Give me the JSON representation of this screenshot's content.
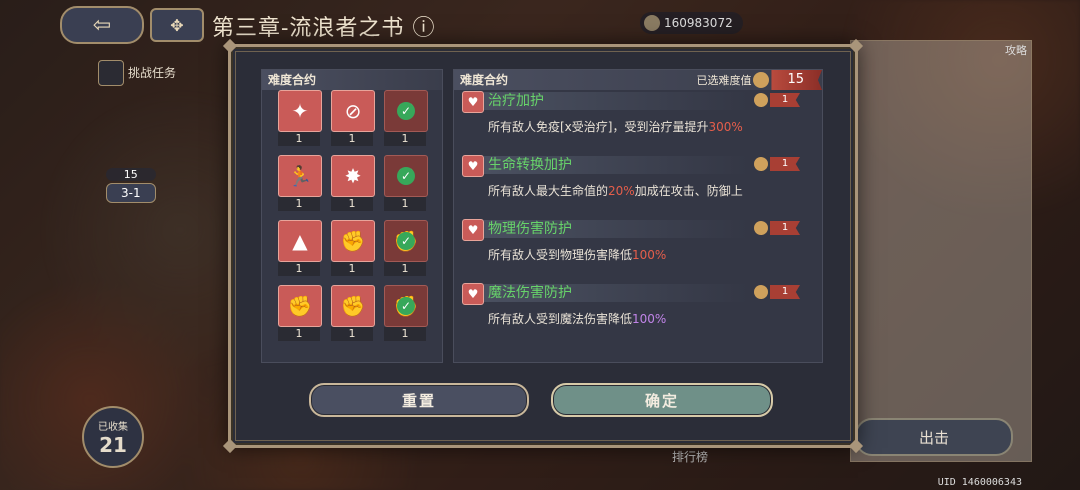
{
  "background": {
    "chapter_title": "第三章-流浪者之书",
    "currency_value": "160983072",
    "challenge_label": "挑战任务",
    "stage_level": "15",
    "stage_name": "3-1",
    "collected_label": "已收集",
    "collected_value": "21",
    "guide_label": "攻略",
    "depart_label": "出击",
    "rank_label": "排行榜",
    "uid": "UID 1460006343"
  },
  "modal": {
    "left_header": "难度合约",
    "right_header": "难度合约",
    "selected_label": "已选难度值",
    "selected_value": "15",
    "tiles": [
      {
        "icon": "starburst-icon",
        "glyph": "✦",
        "count": "1",
        "style": "light",
        "checked": false
      },
      {
        "icon": "heal-ban-icon",
        "glyph": "⊘",
        "count": "1",
        "style": "light",
        "checked": false
      },
      {
        "icon": "heart-check-icon",
        "glyph": "♥",
        "count": "1",
        "style": "dark",
        "checked": true
      },
      {
        "icon": "running-figure-icon",
        "glyph": "🏃",
        "count": "1",
        "style": "light",
        "checked": false
      },
      {
        "icon": "star-burst-icon",
        "glyph": "✸",
        "count": "1",
        "style": "light",
        "checked": false
      },
      {
        "icon": "heart-plus-icon",
        "glyph": "♥",
        "count": "1",
        "style": "dark",
        "checked": true
      },
      {
        "icon": "boot-up-icon",
        "glyph": "▲",
        "count": "1",
        "style": "light",
        "checked": false
      },
      {
        "icon": "shield-fist-icon",
        "glyph": "✊",
        "count": "1",
        "style": "light",
        "checked": false
      },
      {
        "icon": "shield-fist-check-icon",
        "glyph": "✊",
        "count": "1",
        "style": "dark",
        "checked": true
      },
      {
        "icon": "magic-shield-icon",
        "glyph": "✊",
        "count": "1",
        "style": "light",
        "checked": false
      },
      {
        "icon": "magic-shield-icon",
        "glyph": "✊",
        "count": "1",
        "style": "light",
        "checked": false
      },
      {
        "icon": "magic-shield-check-icon",
        "glyph": "✊",
        "count": "1",
        "style": "dark",
        "checked": true
      }
    ],
    "entries": [
      {
        "title": "治疗加护",
        "value": "1",
        "desc_prefix": "所有敌人免疫[x受治疗]，受到治疗量提升",
        "desc_highlight": "300%",
        "desc_suffix": "",
        "highlight_color": "red"
      },
      {
        "title": "生命转换加护",
        "value": "1",
        "desc_prefix": "所有敌人最大生命值的",
        "desc_highlight": "20%",
        "desc_suffix": "加成在攻击、防御上",
        "highlight_color": "red"
      },
      {
        "title": "物理伤害防护",
        "value": "1",
        "desc_prefix": "所有敌人受到物理伤害降低",
        "desc_highlight": "100%",
        "desc_suffix": "",
        "highlight_color": "red"
      },
      {
        "title": "魔法伤害防护",
        "value": "1",
        "desc_prefix": "所有敌人受到魔法伤害降低",
        "desc_highlight": "100%",
        "desc_suffix": "",
        "highlight_color": "purple"
      }
    ],
    "reset_label": "重置",
    "confirm_label": "确定"
  }
}
